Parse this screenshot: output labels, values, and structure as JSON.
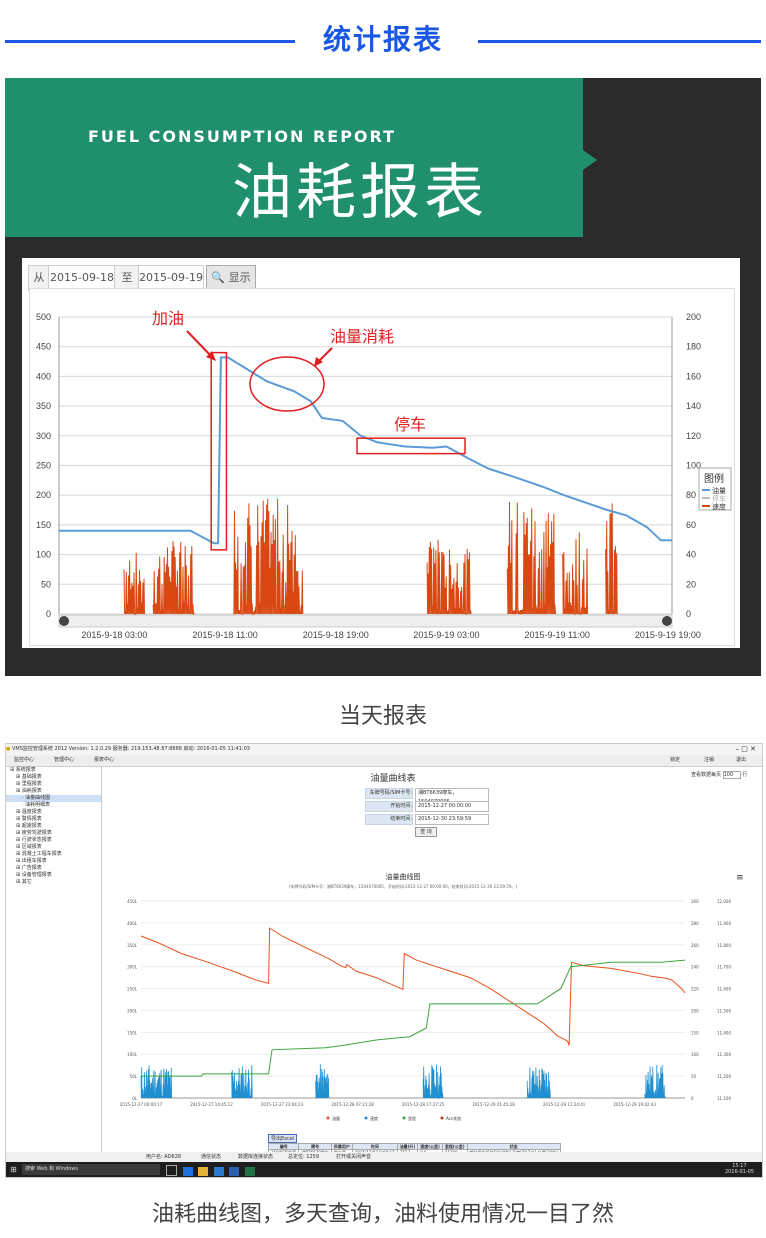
{
  "header": {
    "title": "统计报表"
  },
  "banner": {
    "subtitle_en": "FUEL CONSUMPTION REPORT",
    "title_cn": "油耗报表"
  },
  "report1": {
    "from_label": "从",
    "from_value": "2015-09-18",
    "to_label": "至",
    "to_value": "2015-09-19",
    "show_button": "显示",
    "annotations": {
      "refuel": "加油",
      "consumption": "油量消耗",
      "parking": "停车"
    }
  },
  "caption1": "当天报表",
  "caption2": "油耗曲线图，多天查询，油料使用情况一目了然",
  "colors": {
    "accent_blue": "#1a57e6",
    "banner_green": "#1f8f6e",
    "fuel_line": "#5b9bd5",
    "speed_line": "#d94812",
    "annotation_red": "#e02020"
  },
  "chart_data": [
    {
      "type": "line",
      "x_ticks": [
        "2015-9-18 03:00",
        "2015-9-18 11:00",
        "2015-9-18 19:00",
        "2015-9-19 03:00",
        "2015-9-19 11:00",
        "2015-9-19 19:00"
      ],
      "ylim_left": [
        0,
        500
      ],
      "yticks_left": [
        0,
        50,
        100,
        150,
        200,
        250,
        300,
        350,
        400,
        450,
        500
      ],
      "ylim_right": [
        0,
        200
      ],
      "yticks_right": [
        0,
        20,
        40,
        60,
        80,
        100,
        120,
        140,
        160,
        180,
        200
      ],
      "legend": {
        "title": "图例",
        "position": "right",
        "entries": [
          "油量",
          "停车",
          "速度"
        ]
      },
      "grid": true,
      "series": [
        {
          "name": "油量",
          "points": [
            [
              0,
              140
            ],
            [
              6,
              140
            ],
            [
              9.5,
              140
            ],
            [
              11.2,
              119
            ],
            [
              11.5,
              119
            ],
            [
              11.7,
              432
            ],
            [
              12.2,
              432
            ],
            [
              13.4,
              415
            ],
            [
              15,
              392
            ],
            [
              17,
              375
            ],
            [
              18.2,
              358
            ],
            [
              19,
              330
            ],
            [
              20.5,
              325
            ],
            [
              21.8,
              300
            ],
            [
              23,
              289
            ],
            [
              25,
              282
            ],
            [
              27,
              280
            ],
            [
              28,
              282
            ],
            [
              29.5,
              263
            ],
            [
              31,
              245
            ],
            [
              33,
              230
            ],
            [
              35,
              214
            ],
            [
              36.5,
              200
            ],
            [
              38,
              188
            ],
            [
              39.5,
              176
            ],
            [
              41,
              166
            ],
            [
              42.5,
              146
            ],
            [
              43.5,
              124
            ],
            [
              44.3,
              124
            ]
          ]
        },
        {
          "name": "速度",
          "axis": "right",
          "bursts": [
            [
              4.7,
              6.2,
              42
            ],
            [
              6.8,
              9.8,
              50
            ],
            [
              12.6,
              17.2,
              78
            ],
            [
              16.3,
              17.6,
              30
            ],
            [
              26.6,
              27.5,
              60
            ],
            [
              27.5,
              29.8,
              44
            ],
            [
              32.4,
              35.9,
              78
            ],
            [
              36.4,
              38.2,
              55
            ],
            [
              39.5,
              40.3,
              80
            ]
          ]
        }
      ]
    },
    {
      "type": "line",
      "title": "油量曲线图",
      "subtitle": "(车牌号码/SIM卡号：湘BT6639摩车，1504070005，开始时间:2015-12-27 00:00:00，结束时间:2015-12-30 23:59:59。)",
      "x_ticks": [
        "2015-12-27 00:00:17",
        "2015-12-27 14:45:12",
        "2015-12-27 23:04:23",
        "2015-12-28 07:21:28",
        "2015-12-28 17:27:25",
        "2015-12-29 01:45:28",
        "2015-12-29 11:24:41",
        "2015-12-29 19:42:43"
      ],
      "yticks_left": [
        "0L",
        "50L",
        "100L",
        "150L",
        "200L",
        "250L",
        "300L",
        "350L",
        "400L",
        "450L"
      ],
      "yticks_mid": [
        0,
        50,
        100,
        150,
        200,
        220,
        240,
        260,
        280,
        300
      ],
      "yticks_right": [
        "11,100",
        "11,200",
        "11,300",
        "11,400",
        "11,500",
        "11,600",
        "11,700",
        "11,800",
        "11,900",
        "12,000"
      ],
      "legend": {
        "position": "bottom",
        "entries": [
          "油量",
          "速度",
          "里程",
          "Acc状态"
        ]
      },
      "series": [
        {
          "name": "油量",
          "points": [
            [
              0,
              370
            ],
            [
              5,
              355
            ],
            [
              12,
              330
            ],
            [
              20,
              310
            ],
            [
              28,
              288
            ],
            [
              34,
              270
            ],
            [
              38,
              262
            ],
            [
              38.3,
              388
            ],
            [
              42,
              370
            ],
            [
              50,
              340
            ],
            [
              56,
              318
            ],
            [
              60,
              300
            ],
            [
              61,
              298
            ],
            [
              61.3,
              305
            ],
            [
              64,
              290
            ],
            [
              70,
              275
            ],
            [
              76,
              255
            ],
            [
              78,
              248
            ],
            [
              78.4,
              330
            ],
            [
              82,
              315
            ],
            [
              90,
              295
            ],
            [
              98,
              275
            ],
            [
              104,
              250
            ],
            [
              110,
              220
            ],
            [
              116,
              190
            ],
            [
              120,
              170
            ],
            [
              124,
              142
            ],
            [
              127,
              130
            ],
            [
              127.5,
              120
            ],
            [
              128.2,
              310
            ],
            [
              132,
              302
            ],
            [
              140,
              296
            ],
            [
              148,
              285
            ],
            [
              152,
              278
            ],
            [
              156,
              274
            ],
            [
              158,
              270
            ],
            [
              161,
              250
            ],
            [
              162,
              240
            ]
          ]
        },
        {
          "name": "里程",
          "points": [
            [
              0,
              11200
            ],
            [
              18,
              11200
            ],
            [
              18.5,
              11210
            ],
            [
              38,
              11210
            ],
            [
              39,
              11320
            ],
            [
              55,
              11330
            ],
            [
              60,
              11340
            ],
            [
              70,
              11365
            ],
            [
              80,
              11380
            ],
            [
              85,
              11420
            ],
            [
              86,
              11530
            ],
            [
              100,
              11530
            ],
            [
              118,
              11530
            ],
            [
              125,
              11600
            ],
            [
              128,
              11700
            ],
            [
              140,
              11720
            ],
            [
              155,
              11720
            ],
            [
              162,
              11730
            ]
          ]
        }
      ]
    }
  ],
  "app": {
    "titlebar": "VMS监控管理系统 2012  Version: 1.2.0.29  服务器: 219.153.48.87:8888  启动: 2016-01-05 11:41:03",
    "menu": [
      "监控中心",
      "管理中心",
      "报表中心"
    ],
    "menu_right": [
      "锁定",
      "注销",
      "退出"
    ],
    "tree": [
      "系统报表",
      "基础报表",
      "里程报表",
      "油耗报表",
      "油量曲线图",
      "油耗明细表",
      "温度报表",
      "警情报表",
      "超速报表",
      "疲劳驾驶报表",
      "行驶状态报表",
      "区域报表",
      "混凝土工程车报表",
      "出租车报表",
      "广告报表",
      "设备管理报表",
      "其它"
    ],
    "form": {
      "title": "油量曲线表",
      "plate_label": "车牌号码/SIM卡号:",
      "plate_value": "湘BT6639摩车，1504070005",
      "start_label": "开始时间:",
      "start_value": "2015-12-27 00:00:00",
      "end_label": "结束时间:",
      "end_value": "2015-12-30 23:59:59",
      "query_button": "查 询",
      "page_rows_label": "查看数据每页",
      "page_rows_value": "100",
      "page_rows_unit": "行"
    },
    "export_button": "导出Excel",
    "table_headers": [
      "编号",
      "牌号",
      "所属用户",
      "时间",
      "油量(升)",
      "速度(公里)",
      "里程(公里)",
      "状态"
    ],
    "table_rows": [
      [
        "1504070005",
        "湘BT6639摩车",
        "罗立西",
        "2015/12/07 0:00:17",
        "372.1",
        "0.0",
        "11200",
        "超时停车[5时10分9秒],高度[39.7米],启用[30秒]"
      ],
      [
        "1504070005",
        "湘BT6639摩车",
        "罗立西",
        "2015/12/07 0:00:47",
        "372.1",
        "0.0",
        "11200",
        "超时停车[5时10分9秒],高度[44.7米],启用[30秒]"
      ],
      [
        "1504070005",
        "湘BT6639摩车",
        "罗立西",
        "2015/12/07 0:01:17",
        "372.1",
        "0.0",
        "11200",
        "超时停车[5时10分9秒],高度[46.9米],启用[30秒]"
      ]
    ],
    "status_bar": [
      "用户名: AD628",
      "通信状态",
      "数据库连接状态",
      "总定位: 1259",
      "打开或关闭声音"
    ],
    "taskbar": {
      "search": "搜索 Web 和 Windows",
      "time": "15:17",
      "date": "2016-01-05"
    }
  }
}
